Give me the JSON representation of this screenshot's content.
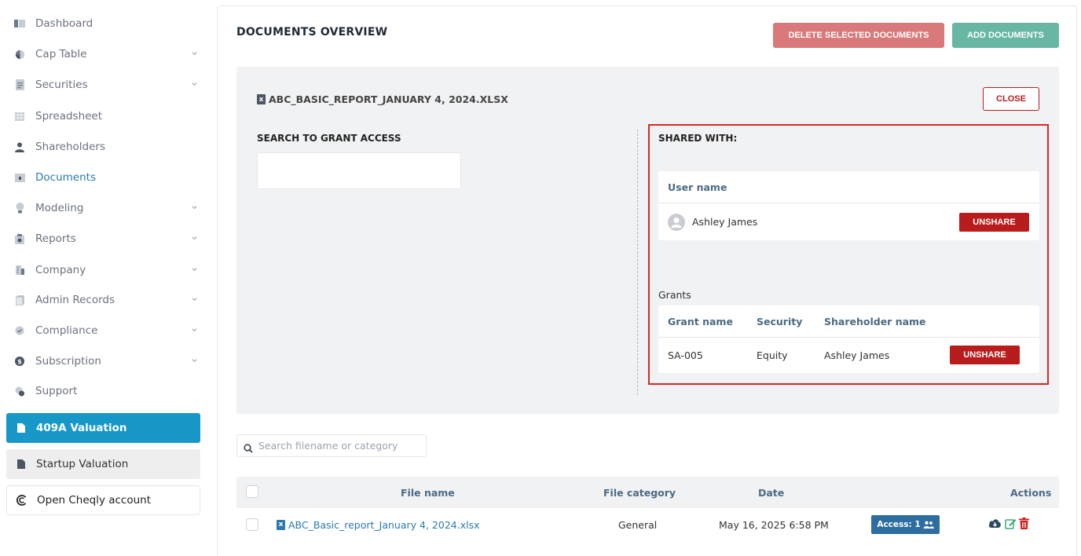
{
  "sidebar": {
    "items": [
      {
        "label": "Dashboard",
        "icon": "dashboard-icon",
        "chevron": false
      },
      {
        "label": "Cap Table",
        "icon": "pie-chart-icon",
        "chevron": true
      },
      {
        "label": "Securities",
        "icon": "document-icon",
        "chevron": true
      },
      {
        "label": "Spreadsheet",
        "icon": "table-icon",
        "chevron": false
      },
      {
        "label": "Shareholders",
        "icon": "user-icon",
        "chevron": false
      },
      {
        "label": "Documents",
        "icon": "folder-icon",
        "chevron": false,
        "active": true
      },
      {
        "label": "Modeling",
        "icon": "lightbulb-icon",
        "chevron": true
      },
      {
        "label": "Reports",
        "icon": "report-icon",
        "chevron": true
      },
      {
        "label": "Company",
        "icon": "building-icon",
        "chevron": true
      },
      {
        "label": "Admin Records",
        "icon": "records-icon",
        "chevron": true
      },
      {
        "label": "Compliance",
        "icon": "shield-check-icon",
        "chevron": true
      },
      {
        "label": "Subscription",
        "icon": "dollar-circle-icon",
        "chevron": true
      },
      {
        "label": "Support",
        "icon": "support-icon",
        "chevron": false
      }
    ],
    "valuation_409a": "409A Valuation",
    "startup_valuation": "Startup Valuation",
    "open_cheqly": "Open Cheqly account"
  },
  "header": {
    "title": "DOCUMENTS OVERVIEW",
    "delete_label": "DELETE SELECTED DOCUMENTS",
    "add_label": "ADD DOCUMENTS"
  },
  "share_panel": {
    "file_name": "ABC_BASIC_REPORT_JANUARY 4, 2024.XLSX",
    "close_label": "CLOSE",
    "search_label": "SEARCH TO GRANT ACCESS",
    "search_value": "",
    "shared_with_label": "SHARED WITH:",
    "user_table": {
      "header": "User name",
      "rows": [
        {
          "name": "Ashley James",
          "action": "UNSHARE"
        }
      ]
    },
    "grants_label": "Grants",
    "grants_table": {
      "headers": [
        "Grant name",
        "Security",
        "Shareholder name"
      ],
      "rows": [
        {
          "grant": "SA-005",
          "security": "Equity",
          "shareholder": "Ashley James",
          "action": "UNSHARE"
        }
      ]
    }
  },
  "documents": {
    "search_placeholder": "Search filename or category",
    "columns": {
      "file_name": "File name",
      "category": "File category",
      "date": "Date",
      "actions": "Actions"
    },
    "rows": [
      {
        "file_name": "ABC_Basic_report_January 4, 2024.xlsx",
        "category": "General",
        "date": "May 16, 2025 6:58 PM",
        "access": "Access: 1"
      }
    ]
  },
  "colors": {
    "primary": "#1798c9",
    "danger": "#b91c1c",
    "success": "#67b7a4",
    "highlight": "#dc2626"
  }
}
